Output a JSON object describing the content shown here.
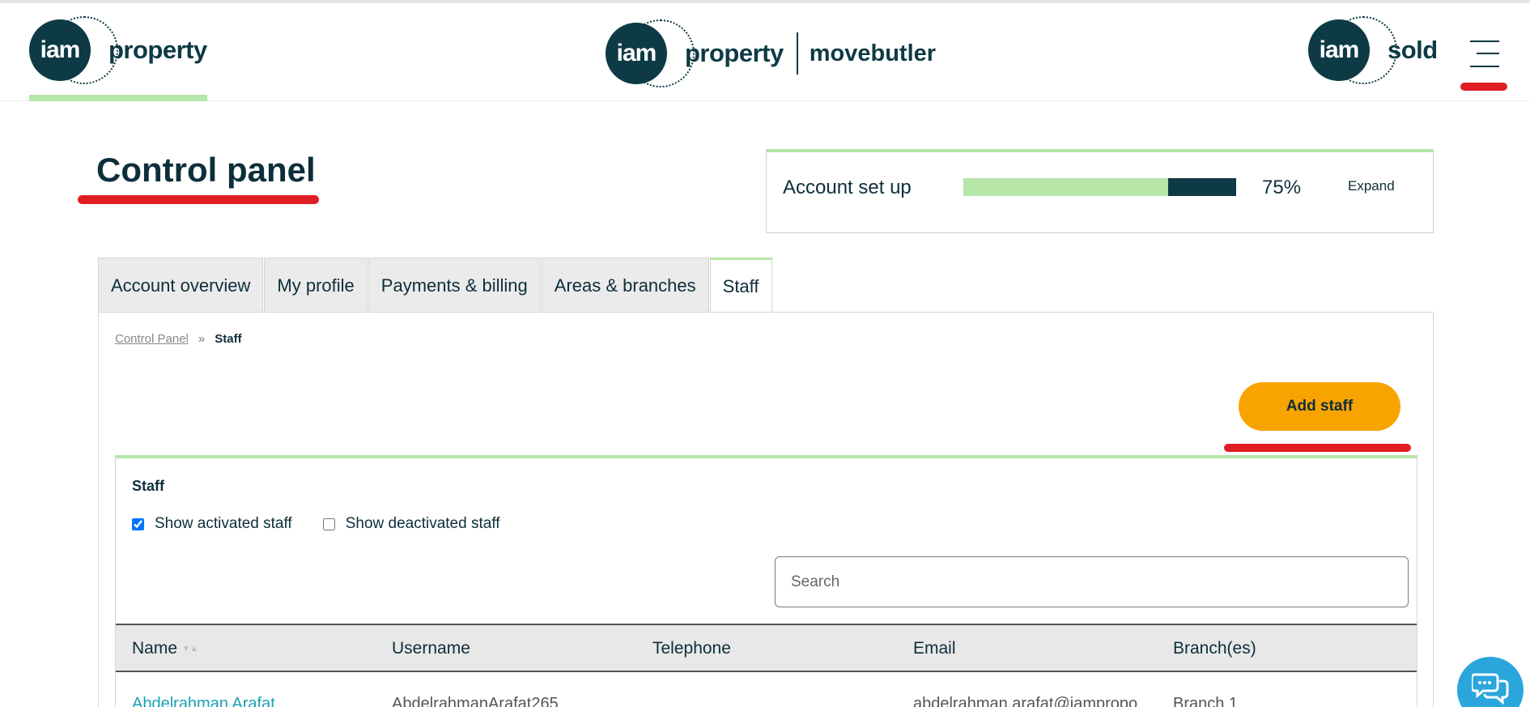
{
  "header": {
    "left_logo": {
      "badge": "iam",
      "word": "property"
    },
    "center_logo": {
      "badge": "iam",
      "word": "property",
      "partner": "movebutler"
    },
    "right_logo": {
      "badge": "iam",
      "word": "sold"
    },
    "menu_icon": "hamburger-menu-icon"
  },
  "page": {
    "title": "Control panel"
  },
  "account_setup": {
    "label": "Account set up",
    "progress_percent": 75,
    "percent_label": "75%",
    "expand_label": "Expand"
  },
  "tabs": [
    {
      "label": "Account overview",
      "active": false
    },
    {
      "label": "My profile",
      "active": false
    },
    {
      "label": "Payments & billing",
      "active": false
    },
    {
      "label": "Areas & branches",
      "active": false
    },
    {
      "label": "Staff",
      "active": true
    }
  ],
  "breadcrumb": {
    "root": "Control Panel",
    "separator": "»",
    "current": "Staff"
  },
  "actions": {
    "add_staff_label": "Add staff"
  },
  "staff": {
    "title": "Staff",
    "filters": [
      {
        "label": "Show activated staff",
        "checked": true
      },
      {
        "label": "Show deactivated staff",
        "checked": false
      }
    ],
    "search_placeholder": "Search",
    "columns": [
      "Name",
      "Username",
      "Telephone",
      "Email",
      "Branch(es)"
    ],
    "rows": [
      {
        "name": "Abdelrahman Arafat",
        "username": "AbdelrahmanArafat265",
        "telephone": "",
        "email": "abdelrahman.arafat@iampropo",
        "branches": "Branch 1"
      }
    ]
  },
  "colors": {
    "brand_dark": "#0d3a44",
    "accent_green": "#b5e6a8",
    "cta_orange": "#f9a300",
    "annotation_red": "#e11d24",
    "chat_blue": "#2aa6dd",
    "link_teal": "#1aa3b3"
  }
}
